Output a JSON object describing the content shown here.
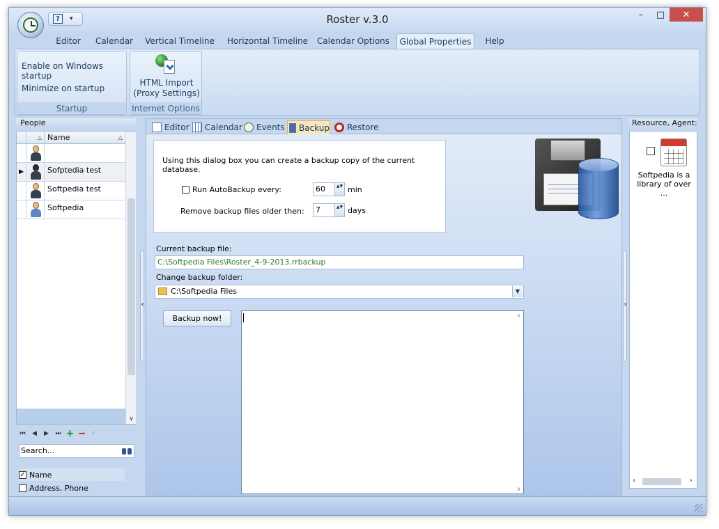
{
  "window": {
    "title": "Roster v.3.0",
    "minimize": "–",
    "maximize": "□",
    "close": "✕"
  },
  "qat": {
    "help": "?",
    "dropdown": "▾"
  },
  "ribbon": {
    "tabs": [
      {
        "label": "Editor"
      },
      {
        "label": "Calendar"
      },
      {
        "label": "Vertical Timeline"
      },
      {
        "label": "Horizontal Timeline"
      },
      {
        "label": "Calendar Options"
      },
      {
        "label": "Global Properties"
      },
      {
        "label": "Help"
      }
    ],
    "active_tab": "Global Properties",
    "startup_group": {
      "label": "Startup",
      "enable_startup": "Enable on Windows startup",
      "minimize_startup": "Minimize on startup"
    },
    "internet_group": {
      "label": "Internet Options",
      "html_import_line1": "HTML Import",
      "html_import_line2": "(Proxy Settings)"
    }
  },
  "people": {
    "header": "People",
    "columns": {
      "image_sort": "△",
      "name": "Name",
      "name_sort": "△"
    },
    "rows": [
      {
        "name": "",
        "selected": false,
        "indicator": ""
      },
      {
        "name": "Sofptedia test",
        "selected": true,
        "indicator": "▶"
      },
      {
        "name": "Softpedia test",
        "selected": false,
        "indicator": ""
      },
      {
        "name": "Softpedia",
        "selected": false,
        "indicator": ""
      }
    ],
    "scroll_down": "∨",
    "nav": {
      "first": "⏮",
      "prev": "◀",
      "next": "▶",
      "last": "⏭",
      "add": "+",
      "delete": "−",
      "confirm": "✓"
    },
    "search_value": "Search...",
    "filters": [
      {
        "label": "Name",
        "checked": true,
        "mark": "✓"
      },
      {
        "label": "Address, Phone",
        "checked": false,
        "mark": ""
      }
    ]
  },
  "splitters": {
    "left_arrow": "‹",
    "right_arrow": "›"
  },
  "subtabs": [
    {
      "label": "Editor"
    },
    {
      "label": "Calendar"
    },
    {
      "label": "Events"
    },
    {
      "label": "Backup"
    },
    {
      "label": "Restore"
    }
  ],
  "backup": {
    "info": "Using this dialog box you can create a backup copy of the current database.",
    "autobackup_label": "Run AutoBackup every:",
    "autobackup_checked": false,
    "autobackup_value": "60",
    "autobackup_unit": "min",
    "remove_label": "Remove backup files older then:",
    "remove_value": "7",
    "remove_unit": "days",
    "spin_arrows": "▲▼",
    "current_file_label": "Current backup file:",
    "current_file": "C:\\Softpedia Files\\Roster_4-9-2013.rrbackup",
    "change_folder_label": "Change backup folder:",
    "folder": "C:\\Softpedia Files",
    "folder_arrow": "▼",
    "backup_button": "Backup now!",
    "log_scroll_up": "∧",
    "log_scroll_down": "∨"
  },
  "resource": {
    "header": "Resource, Agent:",
    "text": "Softpedia is a library of over ...",
    "scroll_left": "‹",
    "scroll_right": "›"
  }
}
